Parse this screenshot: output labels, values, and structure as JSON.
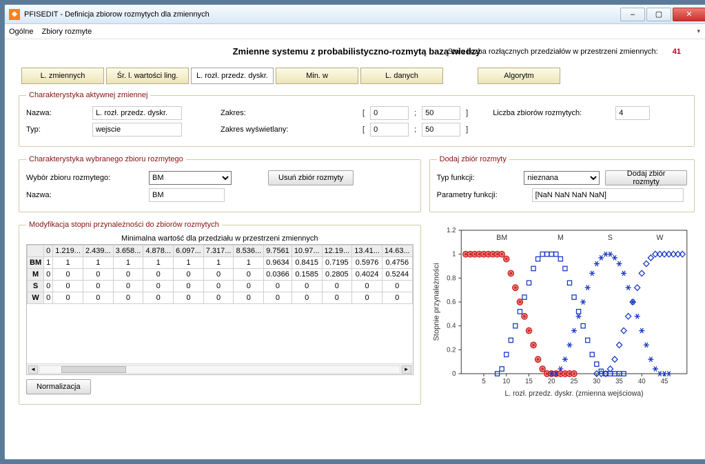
{
  "window": {
    "title": "PFISEDIT - Definicja zbiorow rozmytych dla zmiennych"
  },
  "menu": {
    "ogolne": "Ogólne",
    "zbiory": "Zbiory rozmyte"
  },
  "header": {
    "main": "Zmienne systemu z probabilistyczno-rozmytą bazą wiedzy",
    "right_label": "Stała liczba rozłącznych przedziałów w przestrzeni zmiennych:",
    "right_value": "41"
  },
  "tabs": {
    "t1": "L. zmiennych",
    "t2": "Śr. l. wartości ling.",
    "t3": "L. rozł. przedz. dyskr.",
    "t4": "Min. w",
    "t5": "L. danych",
    "t6": "Algorytm"
  },
  "char_active": {
    "legend": "Charakterystyka aktywnej zmiennej",
    "nazwa_lbl": "Nazwa:",
    "nazwa_val": "L. rozł. przedz. dyskr.",
    "typ_lbl": "Typ:",
    "typ_val": "wejscie",
    "zakres_lbl": "Zakres:",
    "zakres_min": "0",
    "zakres_max": "50",
    "zakres_wys_lbl": "Zakres wyświetlany:",
    "zakres_wys_min": "0",
    "zakres_wys_max": "50",
    "liczba_lbl": "Liczba zbiorów rozmytych:",
    "liczba_val": "4"
  },
  "char_fuzzy": {
    "legend": "Charakterystyka wybranego zbioru rozmytego",
    "wybor_lbl": "Wybór zbioru rozmytego:",
    "wybor_val": "BM",
    "usun_btn": "Usuń zbiór rozmyty",
    "nazwa_lbl": "Nazwa:",
    "nazwa_val": "BM"
  },
  "dodaj": {
    "legend": "Dodaj zbiór rozmyty",
    "typ_lbl": "Typ funkcji:",
    "typ_val": "nieznana",
    "dodaj_btn": "Dodaj zbiór rozmyty",
    "param_lbl": "Parametry funkcji:",
    "param_val": "[NaN NaN NaN NaN]"
  },
  "mod": {
    "legend": "Modyfikacja stopni przynależności do zbiorów rozmytych",
    "subtitle": "Minimalna wartość dla przedziału w przestrzeni zmiennych",
    "norm_btn": "Normalizacja",
    "cols": [
      "0",
      "1.219...",
      "2.439...",
      "3.658...",
      "4.878...",
      "6.097...",
      "7.317...",
      "8.536...",
      "9.7561",
      "10.97...",
      "12.19...",
      "13.41...",
      "14.63..."
    ],
    "rows": [
      "BM",
      "M",
      "S",
      "W"
    ],
    "data": {
      "BM": [
        "1",
        "1",
        "1",
        "1",
        "1",
        "1",
        "1",
        "1",
        "0.9634",
        "0.8415",
        "0.7195",
        "0.5976",
        "0.4756"
      ],
      "M": [
        "0",
        "0",
        "0",
        "0",
        "0",
        "0",
        "0",
        "0",
        "0.0366",
        "0.1585",
        "0.2805",
        "0.4024",
        "0.5244"
      ],
      "S": [
        "0",
        "0",
        "0",
        "0",
        "0",
        "0",
        "0",
        "0",
        "0",
        "0",
        "0",
        "0",
        "0"
      ],
      "W": [
        "0",
        "0",
        "0",
        "0",
        "0",
        "0",
        "0",
        "0",
        "0",
        "0",
        "0",
        "0",
        "0"
      ]
    }
  },
  "chart_data": {
    "type": "scatter",
    "title": "",
    "xlabel": "L. rozł. przedz. dyskr. (zmienna wejściowa)",
    "ylabel": "Stopnie przynależności",
    "xlim": [
      0,
      50
    ],
    "ylim": [
      0,
      1.2
    ],
    "xticks": [
      5,
      10,
      15,
      20,
      25,
      30,
      35,
      40,
      45
    ],
    "yticks": [
      0,
      0.2,
      0.4,
      0.6,
      0.8,
      1.0,
      1.2
    ],
    "annotations": [
      {
        "x": 9,
        "y": 1.12,
        "text": "BM"
      },
      {
        "x": 22,
        "y": 1.12,
        "text": "M"
      },
      {
        "x": 33,
        "y": 1.12,
        "text": "S"
      },
      {
        "x": 44,
        "y": 1.12,
        "text": "W"
      }
    ],
    "series": [
      {
        "name": "BM",
        "symbol": "asterisk-circle",
        "color": "#d02020",
        "x": [
          1,
          2,
          3,
          4,
          5,
          6,
          7,
          8,
          9,
          10,
          11,
          12,
          13,
          14,
          15,
          16,
          17,
          18,
          19,
          20,
          21,
          22,
          23,
          24,
          25
        ],
        "y": [
          1,
          1,
          1,
          1,
          1,
          1,
          1,
          1,
          1,
          0.96,
          0.84,
          0.72,
          0.6,
          0.48,
          0.36,
          0.24,
          0.12,
          0.04,
          0,
          0,
          0,
          0,
          0,
          0,
          0
        ]
      },
      {
        "name": "M",
        "symbol": "square",
        "color": "#1637c3",
        "x": [
          8,
          9,
          10,
          11,
          12,
          13,
          14,
          15,
          16,
          17,
          18,
          19,
          20,
          21,
          22,
          23,
          24,
          25,
          26,
          27,
          28,
          29,
          30,
          31,
          32,
          33,
          34,
          35,
          36
        ],
        "y": [
          0,
          0.04,
          0.16,
          0.28,
          0.4,
          0.52,
          0.64,
          0.76,
          0.88,
          0.96,
          1.0,
          1.0,
          1.0,
          1.0,
          0.96,
          0.88,
          0.76,
          0.64,
          0.52,
          0.4,
          0.28,
          0.16,
          0.08,
          0.02,
          0,
          0,
          0,
          0,
          0
        ]
      },
      {
        "name": "S",
        "symbol": "asterisk",
        "color": "#1637c3",
        "x": [
          20,
          21,
          22,
          23,
          24,
          25,
          26,
          27,
          28,
          29,
          30,
          31,
          32,
          33,
          34,
          35,
          36,
          37,
          38,
          39,
          40,
          41,
          42,
          43,
          44,
          45,
          46
        ],
        "y": [
          0,
          0,
          0.04,
          0.12,
          0.24,
          0.36,
          0.48,
          0.6,
          0.72,
          0.84,
          0.92,
          0.97,
          1.0,
          1.0,
          0.97,
          0.92,
          0.84,
          0.72,
          0.6,
          0.48,
          0.36,
          0.24,
          0.12,
          0.04,
          0,
          0,
          0
        ]
      },
      {
        "name": "W",
        "symbol": "diamond",
        "color": "#1637c3",
        "x": [
          30,
          31,
          32,
          33,
          34,
          35,
          36,
          37,
          38,
          39,
          40,
          41,
          42,
          43,
          44,
          45,
          46,
          47,
          48,
          49
        ],
        "y": [
          0,
          0,
          0,
          0.04,
          0.12,
          0.24,
          0.36,
          0.48,
          0.6,
          0.72,
          0.84,
          0.92,
          0.97,
          1.0,
          1.0,
          1.0,
          1.0,
          1.0,
          1.0,
          1.0
        ]
      }
    ]
  }
}
